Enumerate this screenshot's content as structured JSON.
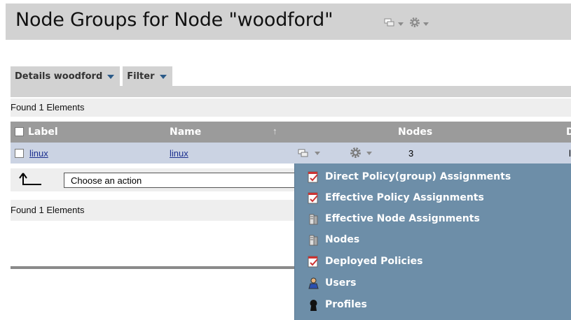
{
  "header": {
    "title": "Node Groups for Node \"woodford\"",
    "icons": [
      "node-view-icon",
      "gear-icon"
    ]
  },
  "tabs": [
    {
      "label": "Details woodford"
    },
    {
      "label": "Filter"
    }
  ],
  "grid": {
    "found_top": "Found 1 Elements",
    "found_bottom": "Found 1 Elements",
    "columns": [
      {
        "label": "Label"
      },
      {
        "label": "Name"
      },
      {
        "label": "Nodes"
      },
      {
        "label": "D"
      }
    ],
    "rows": [
      {
        "label": "linux",
        "name": "linux",
        "nodes": "3",
        "trunc": "li"
      }
    ]
  },
  "actions": {
    "select_value": "Choose an action"
  },
  "context_menu": {
    "items": [
      {
        "label": "Direct Policy(group) Assignments",
        "icon": "policy-icon"
      },
      {
        "label": "Effective Policy Assignments",
        "icon": "policy-icon"
      },
      {
        "label": "Effective Node Assignments",
        "icon": "node-icon"
      },
      {
        "label": "Nodes",
        "icon": "node-icon"
      },
      {
        "label": "Deployed Policies",
        "icon": "policy-icon"
      },
      {
        "label": "Users",
        "icon": "user-icon"
      },
      {
        "label": "Profiles",
        "icon": "profile-icon"
      }
    ]
  },
  "colors": {
    "menu_bg": "#6d8ea8",
    "selected_row": "#cbd3e3",
    "header_bg": "#9b9b9b",
    "title_bar": "#d2d2d2",
    "link": "#1b2f8f"
  }
}
